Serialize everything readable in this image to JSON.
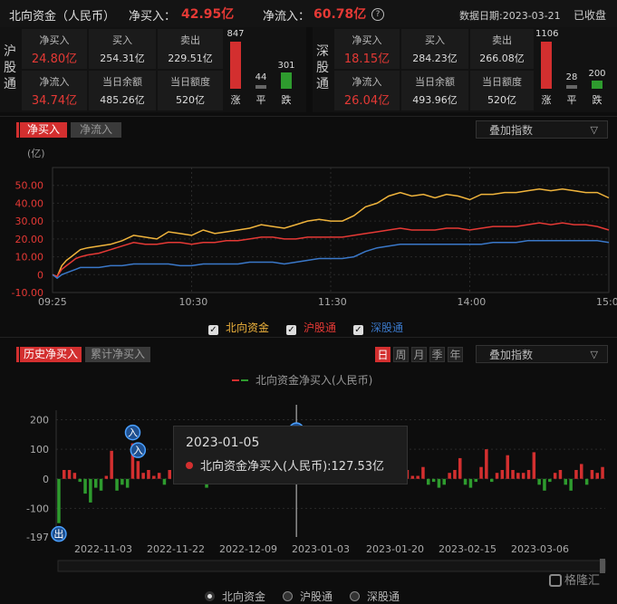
{
  "header": {
    "title": "北向资金（人民币）",
    "net_buy_label": "净买入：",
    "net_buy_value": "42.95亿",
    "net_inflow_label": "净流入：",
    "net_inflow_value": "60.78亿",
    "help_icon": "?",
    "date_text": "数据日期:2023-03-21",
    "status": "已收盘"
  },
  "sh": {
    "label": "沪股通",
    "net_buy_k": "净买入",
    "net_buy_v": "24.80亿",
    "buy_k": "买入",
    "buy_v": "254.31亿",
    "sell_k": "卖出",
    "sell_v": "229.51亿",
    "net_flow_k": "净流入",
    "net_flow_v": "34.74亿",
    "balance_k": "当日余额",
    "balance_v": "485.26亿",
    "quota_k": "当日额度",
    "quota_v": "520亿",
    "up_n": "847",
    "flat_n": "44",
    "down_n": "301",
    "up_k": "涨",
    "flat_k": "平",
    "down_k": "跌"
  },
  "sz": {
    "label": "深股通",
    "net_buy_k": "净买入",
    "net_buy_v": "18.15亿",
    "buy_k": "买入",
    "buy_v": "284.23亿",
    "sell_k": "卖出",
    "sell_v": "266.08亿",
    "net_flow_k": "净流入",
    "net_flow_v": "26.04亿",
    "balance_k": "当日余额",
    "balance_v": "493.96亿",
    "quota_k": "当日额度",
    "quota_v": "520亿",
    "up_n": "1106",
    "flat_n": "28",
    "down_n": "200",
    "up_k": "涨",
    "flat_k": "平",
    "down_k": "跌"
  },
  "intraday": {
    "tab_active": "净买入",
    "tab_other": "净流入",
    "overlay": "叠加指数",
    "unit": "(亿)",
    "legend": [
      "北向资金",
      "沪股通",
      "深股通"
    ]
  },
  "history": {
    "tab_active": "历史净买入",
    "tab_other": "累计净买入",
    "periods": [
      "日",
      "周",
      "月",
      "季",
      "年"
    ],
    "overlay": "叠加指数",
    "legend_title": "北向资金净买入(人民币)",
    "tooltip_date": "2023-01-05",
    "tooltip_text": "北向资金净买入(人民币):127.53亿",
    "radios": [
      "北向资金",
      "沪股通",
      "深股通"
    ],
    "marker_in": "入",
    "marker_out": "出"
  },
  "watermark": "格隆汇",
  "colors": {
    "up": "#d32f2f",
    "down": "#2e9b2e",
    "north": "#f0b43c",
    "sh": "#e53935",
    "sz": "#3a78c9"
  },
  "chart_data": [
    {
      "type": "line",
      "ylabel": "(亿)",
      "ylim": [
        -10,
        60
      ],
      "yticks": [
        "50.00",
        "40.00",
        "30.00",
        "20.00",
        "10.00",
        "0",
        "-10.00"
      ],
      "xticks": [
        "09:25",
        "10:30",
        "11:30",
        "14:00",
        "15:00"
      ],
      "x_minutes": [
        0,
        2,
        4,
        6,
        8,
        10,
        12,
        15,
        20,
        25,
        30,
        35,
        40,
        45,
        50,
        55,
        60,
        65,
        70,
        75,
        80,
        85,
        90,
        95,
        100,
        105,
        110,
        115,
        120,
        125,
        130,
        135,
        140,
        145,
        150,
        155,
        160,
        165,
        170,
        175,
        180,
        185,
        190,
        195,
        200,
        205,
        210,
        215,
        220,
        225,
        230,
        235,
        240
      ],
      "series": [
        {
          "name": "北向资金",
          "values": [
            0,
            -1,
            5,
            8,
            10,
            12,
            14,
            15,
            16,
            17,
            19,
            22,
            21,
            20,
            24,
            23,
            22,
            25,
            23,
            24,
            25,
            26,
            28,
            27,
            26,
            28,
            30,
            31,
            30,
            30,
            33,
            38,
            40,
            44,
            46,
            44,
            45,
            43,
            45,
            44,
            42,
            45,
            45,
            46,
            46,
            47,
            48,
            47,
            48,
            47,
            46,
            46,
            43
          ]
        },
        {
          "name": "沪股通",
          "values": [
            0,
            -1,
            3,
            5,
            7,
            9,
            10,
            11,
            12,
            14,
            16,
            18,
            17,
            17,
            18,
            18,
            17,
            18,
            18,
            19,
            19,
            20,
            21,
            21,
            20,
            20,
            21,
            21,
            21,
            21,
            22,
            23,
            24,
            25,
            26,
            25,
            25,
            25,
            26,
            26,
            25,
            26,
            27,
            27,
            27,
            28,
            29,
            28,
            29,
            28,
            28,
            27,
            25
          ]
        },
        {
          "name": "深股通",
          "values": [
            0,
            -2,
            0,
            1,
            2,
            3,
            4,
            4,
            4,
            5,
            5,
            6,
            6,
            6,
            6,
            5,
            5,
            6,
            6,
            6,
            6,
            7,
            7,
            7,
            6,
            7,
            8,
            9,
            9,
            9,
            10,
            13,
            15,
            16,
            17,
            17,
            17,
            17,
            17,
            17,
            17,
            17,
            18,
            18,
            18,
            19,
            19,
            19,
            19,
            19,
            19,
            19,
            18
          ]
        }
      ]
    },
    {
      "type": "bar",
      "ylim": [
        -197,
        220
      ],
      "yticks": [
        "200",
        "100",
        "0",
        "-100",
        "-197"
      ],
      "xticks": [
        "2022-11-03",
        "2022-11-22",
        "2022-12-09",
        "2023-01-03",
        "2023-01-20",
        "2023-02-15",
        "2023-03-06"
      ],
      "series": [
        {
          "name": "北向资金净买入(人民币)",
          "values": [
            -150,
            30,
            30,
            20,
            -10,
            -50,
            -80,
            -30,
            -40,
            10,
            95,
            -40,
            -20,
            -30,
            120,
            60,
            20,
            30,
            10,
            20,
            -20,
            30,
            40,
            30,
            30,
            40,
            50,
            30,
            -30,
            30,
            20,
            40,
            80,
            10,
            20,
            30,
            30,
            20,
            30,
            50,
            60,
            40,
            30,
            60,
            50,
            127.53,
            80,
            20,
            30,
            50,
            70,
            120,
            60,
            150,
            40,
            30,
            50,
            20,
            60,
            10,
            30,
            90,
            110,
            60,
            80,
            80,
            30,
            10,
            10,
            40,
            -20,
            -10,
            -30,
            -20,
            20,
            30,
            70,
            -20,
            -30,
            -10,
            40,
            100,
            -10,
            20,
            30,
            80,
            30,
            20,
            20,
            30,
            90,
            -20,
            -40,
            -10,
            20,
            30,
            -20,
            -40,
            30,
            50,
            -20,
            30,
            20,
            40
          ]
        }
      ],
      "markers": [
        {
          "index": 0,
          "label": "出"
        },
        {
          "index": 14,
          "label": "入"
        },
        {
          "index": 15,
          "label": "入"
        },
        {
          "index": 45,
          "label": "入"
        },
        {
          "index": 55,
          "label": "入"
        },
        {
          "index": 61,
          "label": "入"
        }
      ],
      "highlight_index": 45
    }
  ]
}
